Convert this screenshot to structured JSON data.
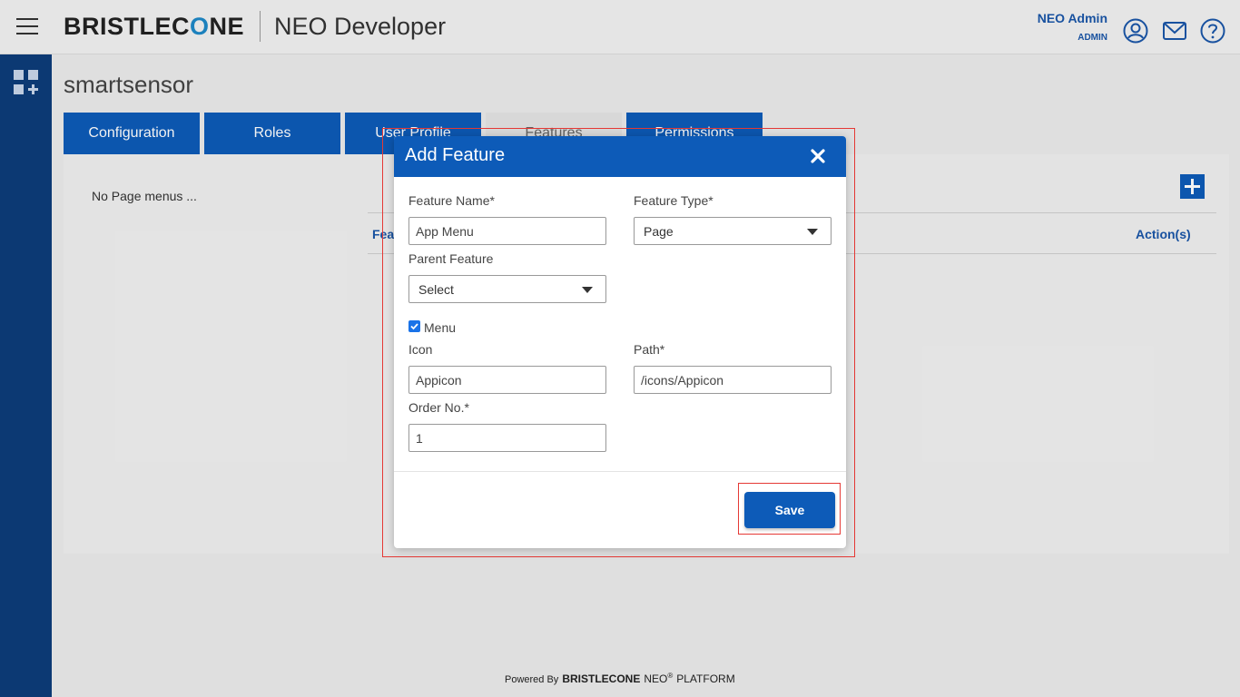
{
  "header": {
    "logo_left": "BRISTLEC",
    "logo_o": "O",
    "logo_right": "NE",
    "app_title": "NEO Developer",
    "user_name": "NEO Admin",
    "user_role": "ADMIN",
    "icons": [
      "menu-icon",
      "user-icon",
      "mail-icon",
      "help-icon"
    ]
  },
  "sidebar": {
    "icon": "apps-add-icon"
  },
  "page": {
    "heading": "smartsensor",
    "tabs": [
      {
        "label": "Configuration",
        "active": false
      },
      {
        "label": "Roles",
        "active": false
      },
      {
        "label": "User Profile",
        "active": false
      },
      {
        "label": "Features",
        "active": true
      },
      {
        "label": "Permissions",
        "active": false
      }
    ],
    "empty_message": "No Page menus ...",
    "table_headers": {
      "first": "Fea",
      "last": "Action(s)"
    }
  },
  "modal": {
    "title": "Add Feature",
    "feature_name_label": "Feature Name*",
    "feature_name_value": "App Menu",
    "feature_type_label": "Feature Type*",
    "feature_type_value": "Page",
    "parent_feature_label": "Parent Feature",
    "parent_feature_value": "Select",
    "menu_label": "Menu",
    "menu_checked": true,
    "icon_label": "Icon",
    "icon_value": "Appicon",
    "path_label": "Path*",
    "path_value": "/icons/Appicon",
    "order_label": "Order No.*",
    "order_value": "1",
    "save_label": "Save"
  },
  "footer": {
    "powered_by": "Powered By",
    "brand": "BRISTLECONE",
    "neo": "NEO",
    "reg": "®",
    "platform": "PLATFORM"
  },
  "colors": {
    "primary": "#0d5bb8",
    "sidebar": "#0d3d7a",
    "link": "#1a56a8",
    "highlight": "#e53935"
  }
}
